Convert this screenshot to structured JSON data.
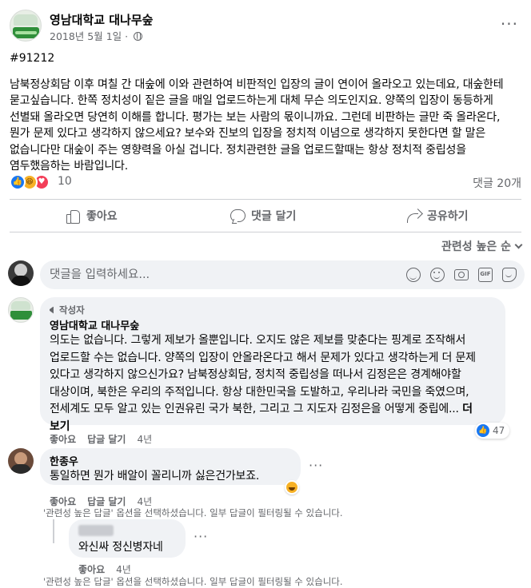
{
  "post": {
    "page_name": "영남대학교 대나무숲",
    "date": "2018년 5월 1일",
    "tag": "#91212",
    "text": "남북정상회담 이후 며칠 간 대숲에 이와 관련하여 비판적인 입장의 글이 연이어 올라오고 있는데요, 대숲한테 묻고싶습니다. 한쪽 정치성이 짙은 글을 매일 업로드하는게 대체 무슨 의도인지요. 양쪽의 입장이 동등하게 선별돼 올라오면 당연히 이해를 합니다. 평가는 보는 사람의 몫이니까요. 그런데 비판하는 글만 죽 올라온다, 뭔가 문제 있다고 생각하지 않으세요? 보수와 진보의 입장을 정치적 이념으로 생각하지 못한다면 할 말은 없습니다만 대숲이 주는 영향력을 아실 겁니다. 정치관련한 글을 업로드할때는 항상 정치적 중립성을 염두했음하는 바람입니다.",
    "reaction_count": "10",
    "comment_count": "댓글 20개"
  },
  "actions": {
    "like": "좋아요",
    "comment": "댓글 달기",
    "share": "공유하기"
  },
  "sort": {
    "label": "관련성 높은 순"
  },
  "composer": {
    "placeholder": "댓글을 입력하세요...",
    "gif_label": "GIF"
  },
  "comments": [
    {
      "badge": "작성자",
      "name": "영남대학교 대나무숲",
      "text": "의도는 없습니다. 그렇게 제보가 올뿐입니다. 오지도 않은 제보를 맞춘다는 핑계로 조작해서 업로드할 수는 없습니다. 양쪽의 입장이 안올라온다고 해서 문제가 있다고 생각하는게 더 문제 있다고 생각하지 않으신가요? 남북정상회담, 정치적 중립성을 떠나서 김정은은 경계해야할 대상이며, 북한은 우리의 주적입니다. 항상 대한민국을 도발하고, 우리나라 국민을 죽였으며, 전세계도 모두 알고 있는 인권유린 국가 북한, 그리고 그 지도자 김정은을 어떻게 중립에...",
      "see_more": "더 보기",
      "like": "좋아요",
      "reply": "답글 달기",
      "time": "4년",
      "likes": "47"
    },
    {
      "name": "한종우",
      "text": "통일하면 뭔가 배알이 꼴리니까 싫은건가보죠.",
      "like": "좋아요",
      "reply": "답글 달기",
      "time": "4년",
      "filter_note": "'관련성 높은 답글' 옵션을 선택하셨습니다. 일부 답글이 필터링될 수 있습니다."
    },
    {
      "text": "와신싸 정신병자네",
      "like": "좋아요",
      "time": "4년",
      "filter_note": "'관련성 높은 답글' 옵션을 선택하셨습니다. 일부 답글이 필터링될 수 있습니다."
    }
  ],
  "colors": {
    "accent": "#1877f2",
    "secondary_text": "#65676b",
    "bubble": "#f0f2f5"
  }
}
